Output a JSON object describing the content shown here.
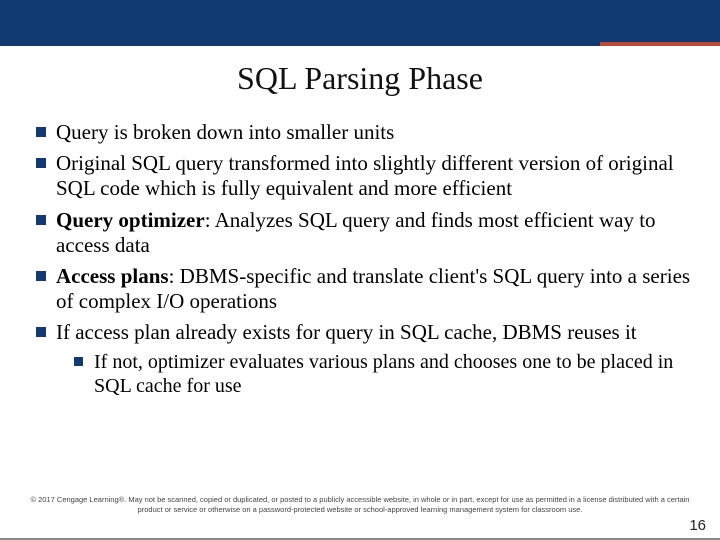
{
  "title": "SQL Parsing Phase",
  "bullets": {
    "b1": "Query is broken down into smaller units",
    "b2": "Original SQL query transformed into slightly different version of original SQL code which is fully equivalent and more efficient",
    "b3_term": "Query optimizer",
    "b3_rest": ": Analyzes SQL query and finds most efficient way to access data",
    "b4_term": "Access plans",
    "b4_rest": ": DBMS-specific and translate client's SQL query into a series of complex I/O operations",
    "b5": "If access plan already exists for query in SQL cache, DBMS reuses it",
    "b5_sub": "If not, optimizer evaluates various plans and chooses one to be placed in SQL cache for use"
  },
  "footer": "© 2017 Cengage Learning®. May not be scanned, copied or duplicated, or posted to a publicly accessible website, in whole or in part, except for use as permitted in a license distributed with a certain product or service or otherwise on a password-protected website or school-approved learning management system for classroom use.",
  "page_number": "16"
}
